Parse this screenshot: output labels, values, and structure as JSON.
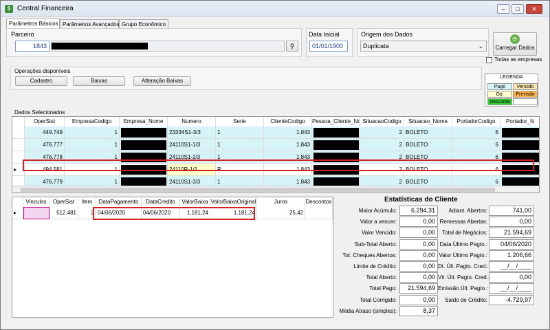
{
  "window": {
    "title": "Central Financeira",
    "min": "–",
    "max": "□",
    "close": "✕"
  },
  "tabs": [
    "Parâmetros Básicos",
    "Parâmetros Avançados",
    "Grupo Econômico"
  ],
  "parceiro": {
    "label": "Parceiro",
    "code": "1843"
  },
  "data_inicial": {
    "label": "Data Inicial",
    "value": "01/01/1900"
  },
  "origem": {
    "label": "Origem dos Dados",
    "value": "Duplicata"
  },
  "carregar": {
    "label": "Carregar Dados"
  },
  "todas": {
    "label": "Todas as empresas"
  },
  "operacoes": {
    "title": "Operações disponíveis",
    "buttons": [
      "Cadastro",
      "Baixas",
      "Alteração Baixas"
    ]
  },
  "legenda": {
    "title": "LEGENDA",
    "items": [
      {
        "label": "Pago",
        "color": "#d6f3f7"
      },
      {
        "label": "Vencido",
        "color": "#fde7b3"
      },
      {
        "label": "Op.",
        "color": "#ffffcc"
      },
      {
        "label": "Previsão",
        "color": "#ffb347"
      },
      {
        "label": "Desconta",
        "color": "#33cc33"
      },
      {
        "label": "",
        "color": "#ffffff"
      }
    ]
  },
  "dados": {
    "title": "Dados Selecionados",
    "headers": [
      "OperSist",
      "EmpresaCodigo",
      "Empresa_Nome",
      "Numero",
      "Serie",
      "ClienteCodigo",
      "Pessoa_Cliente_No",
      "SituacaoCodigo",
      "Situacao_Nome",
      "PortadorCodigo",
      "Portador_N"
    ],
    "rows": [
      [
        "449.749",
        "1",
        "",
        "23334S1-3/3",
        "1",
        "1.843",
        "",
        "2",
        "BOLETO",
        "6",
        ""
      ],
      [
        "476.777",
        "1",
        "",
        "24110S1-1/3",
        "1",
        "1.843",
        "",
        "2",
        "BOLETO",
        "6",
        ""
      ],
      [
        "476.778",
        "1",
        "",
        "24110S1-2/3",
        "1",
        "1.843",
        "",
        "2",
        "BOLETO",
        "6",
        ""
      ],
      [
        "494.581",
        "1",
        "",
        "24110R-1/1",
        "R",
        "1.843",
        "",
        "2",
        "BOLETO",
        "6",
        ""
      ],
      [
        "476.779",
        "1",
        "",
        "24110S1-3/3",
        "1",
        "1.843",
        "",
        "2",
        "BOLETO",
        "6",
        ""
      ]
    ]
  },
  "baixas": {
    "headers": [
      "Vinculos",
      "OperSist",
      "Item",
      "DataPagamento",
      "DataCredito",
      "ValorBaixa",
      "ValorBaixaOriginal",
      "Juros",
      "Descontos"
    ],
    "row": [
      "",
      "512.481",
      "2",
      "04/06/2020",
      "04/06/2020",
      "1.181,24",
      "1.181,24",
      "25,42",
      ""
    ]
  },
  "stats": {
    "title": "Estatísticas do Cliente",
    "left": [
      {
        "label": "Maior Acúmulo:",
        "value": "6.294,31"
      },
      {
        "label": "Valor a vencer:",
        "value": "0,00"
      },
      {
        "label": "Valor Vencido:",
        "value": "0,00"
      },
      {
        "label": "Sub-Total Aberto:",
        "value": "0,00"
      },
      {
        "label": "Tot. Cheques Abertos:",
        "value": "0,00"
      },
      {
        "label": "Limite de Crédito:",
        "value": "0,00"
      },
      {
        "label": "Total Aberto:",
        "value": "0,00"
      },
      {
        "label": "Total Pago:",
        "value": "21.594,69"
      },
      {
        "label": "Total Corrigido:",
        "value": "0,00"
      },
      {
        "label": "Média Atraso (simples):",
        "value": "8,37"
      }
    ],
    "right": [
      {
        "label": "Adiant. Abertos:",
        "value": "741,00"
      },
      {
        "label": "Remessas Abertas:",
        "value": "0,00"
      },
      {
        "label": "Total de Negócios:",
        "value": "21.594,69"
      },
      {
        "label": "Data Último Pagto.:",
        "value": "04/06/2020"
      },
      {
        "label": "Valor Último Pagto.:",
        "value": "1.206,66"
      },
      {
        "label": "Dt. Últ. Pagto. Cred.:",
        "value": "__/__/____"
      },
      {
        "label": "Vlr. Últ. Pagto. Cred.:",
        "value": "0,00"
      },
      {
        "label": "Emissão Últ. Pagto.:",
        "value": "__/__/____"
      },
      {
        "label": "Saldo de Crédito:",
        "value": "-4.729,97"
      }
    ]
  }
}
